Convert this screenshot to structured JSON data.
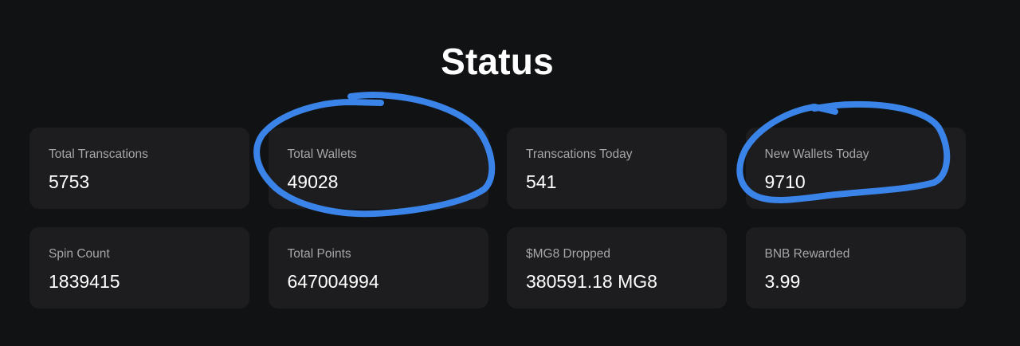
{
  "page": {
    "title": "Status"
  },
  "stats": [
    {
      "label": "Total Transcations",
      "value": "5753"
    },
    {
      "label": "Total Wallets",
      "value": "49028"
    },
    {
      "label": "Transcations Today",
      "value": "541"
    },
    {
      "label": "New Wallets Today",
      "value": "9710"
    },
    {
      "label": "Spin Count",
      "value": "1839415"
    },
    {
      "label": "Total Points",
      "value": "647004994"
    },
    {
      "label": "$MG8 Dropped",
      "value": "380591.18 MG8"
    },
    {
      "label": "BNB Rewarded",
      "value": "3.99"
    }
  ],
  "colors": {
    "background": "#111213",
    "card": "#1d1d1f",
    "label": "#a6a6a9",
    "value": "#ffffff",
    "annotation": "#3a83e8"
  }
}
